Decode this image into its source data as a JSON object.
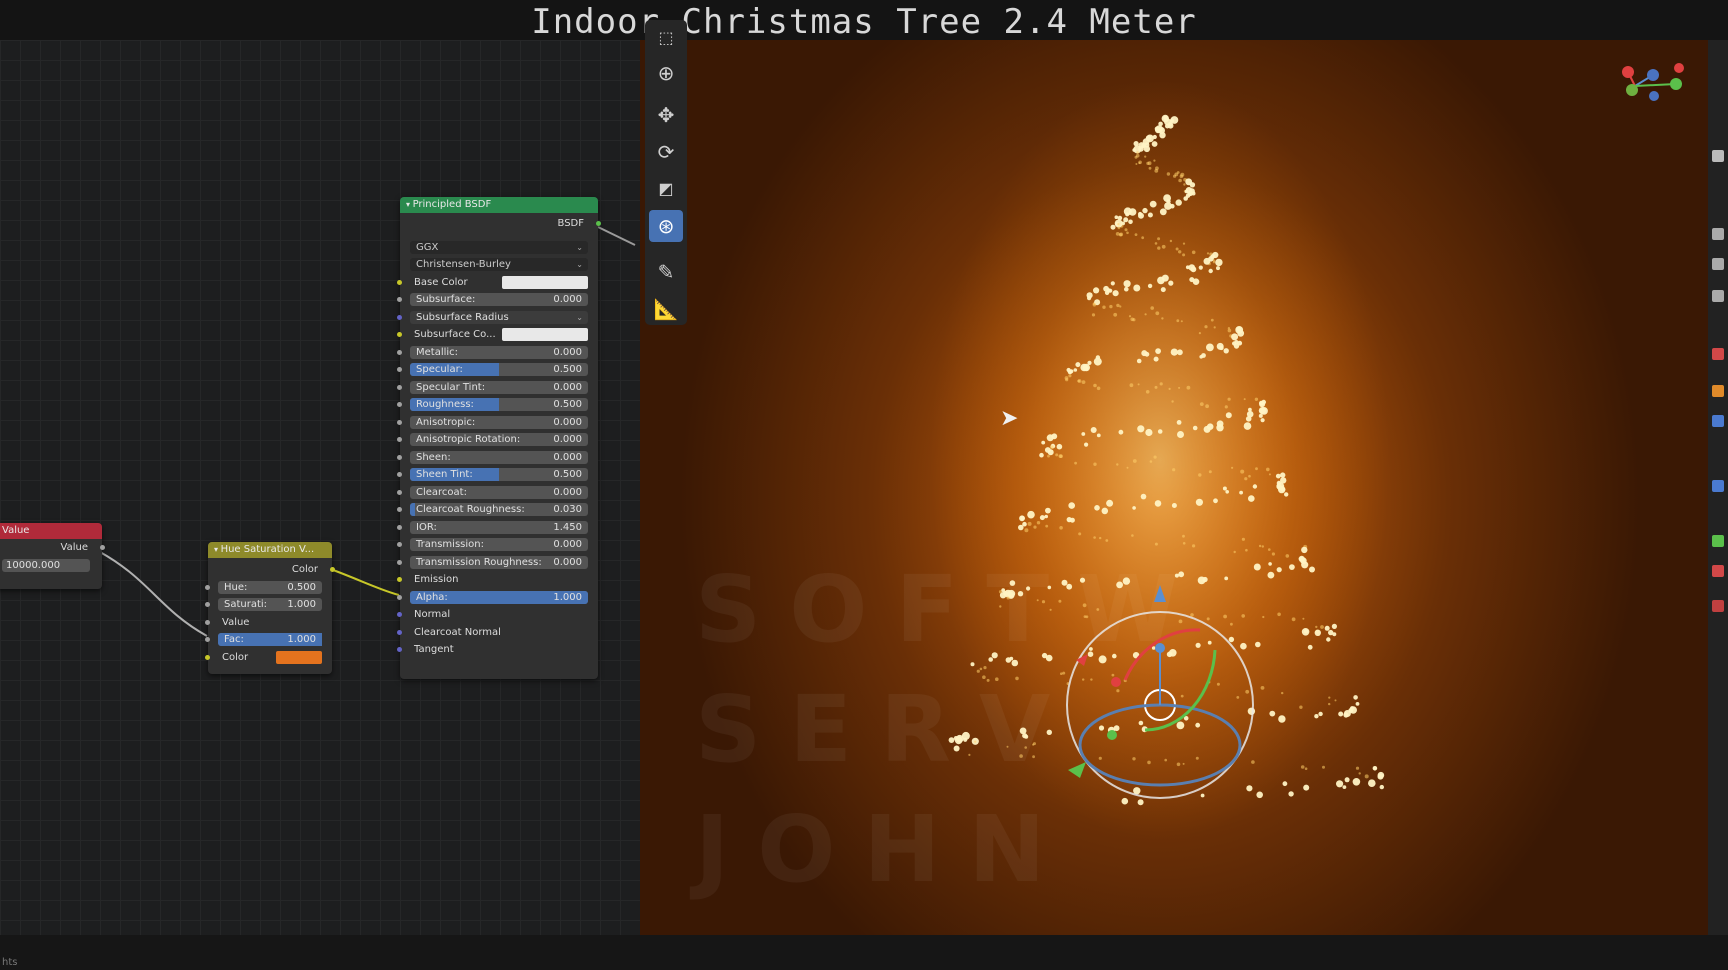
{
  "title": "Indoor Christmas Tree 2.4 Meter",
  "value_node": {
    "header": "Value",
    "output_label": "Value",
    "value": "10000.000",
    "color": "#b02a3a"
  },
  "hsv_node": {
    "header": "Hue Saturation V...",
    "output_label": "Color",
    "hue_label": "Hue:",
    "hue_value": "0.500",
    "sat_label": "Saturati:",
    "sat_value": "1.000",
    "value_label": "Value",
    "fac_label": "Fac:",
    "fac_value": "1.000",
    "fac_fraction": 1.0,
    "color_label": "Color",
    "color_swatch": "#e4731e",
    "header_color": "#8e8a2a"
  },
  "bsdf_node": {
    "header": "Principled BSDF",
    "output_label": "BSDF",
    "header_color": "#2a8a4e",
    "distribution": "GGX",
    "subsurface_method": "Christensen-Burley",
    "base_color_label": "Base Color",
    "subsurface_label": "Subsurface:",
    "subsurface_value": "0.000",
    "subsurface_radius_label": "Subsurface Radius",
    "subsurface_color_label": "Subsurface Co...",
    "metallic_label": "Metallic:",
    "metallic_value": "0.000",
    "specular_label": "Specular:",
    "specular_value": "0.500",
    "specular_tint_label": "Specular Tint:",
    "specular_tint_value": "0.000",
    "roughness_label": "Roughness:",
    "roughness_value": "0.500",
    "anisotropic_label": "Anisotropic:",
    "anisotropic_value": "0.000",
    "anisotropic_rotation_label": "Anisotropic Rotation:",
    "anisotropic_rotation_value": "0.000",
    "sheen_label": "Sheen:",
    "sheen_value": "0.000",
    "sheen_tint_label": "Sheen Tint:",
    "sheen_tint_value": "0.500",
    "clearcoat_label": "Clearcoat:",
    "clearcoat_value": "0.000",
    "clearcoat_roughness_label": "Clearcoat Roughness:",
    "clearcoat_roughness_value": "0.030",
    "ior_label": "IOR:",
    "ior_value": "1.450",
    "transmission_label": "Transmission:",
    "transmission_value": "0.000",
    "transmission_roughness_label": "Transmission Roughness:",
    "transmission_roughness_value": "0.000",
    "emission_label": "Emission",
    "alpha_label": "Alpha:",
    "alpha_value": "1.000",
    "normal_label": "Normal",
    "clearcoat_normal_label": "Clearcoat Normal",
    "tangent_label": "Tangent"
  },
  "watermark": [
    "SOFTW",
    "SERV",
    "JOHN"
  ],
  "status_text": "hts",
  "accent_color": "#4772b3"
}
